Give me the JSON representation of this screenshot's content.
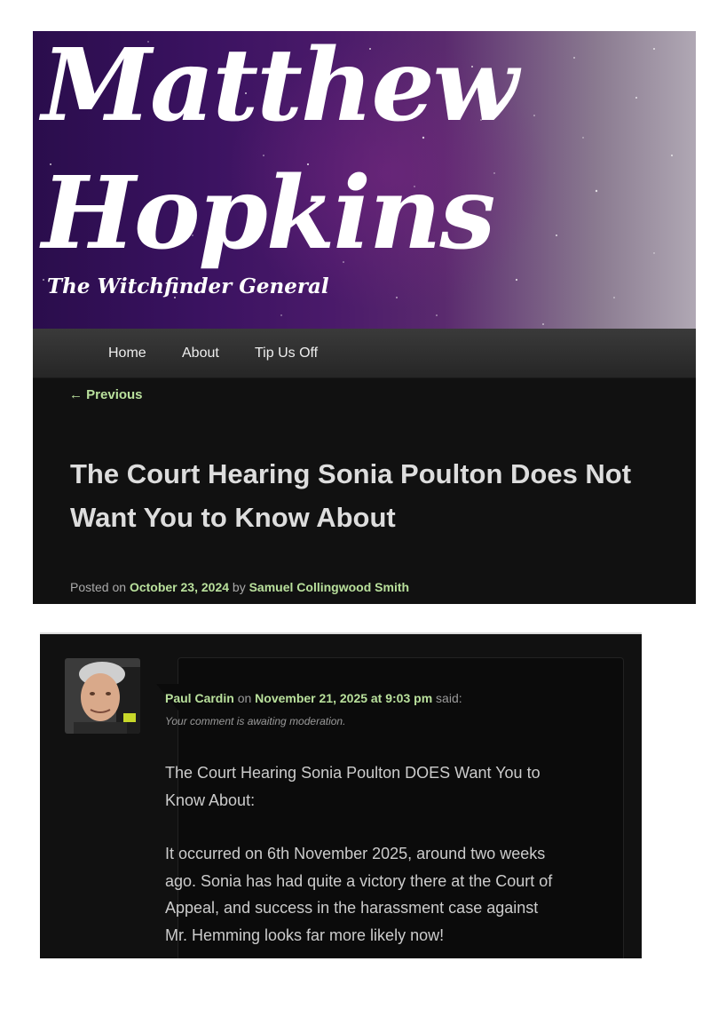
{
  "header": {
    "title_line1": "Matthew",
    "title_line2": "Hopkins",
    "tagline": "The Witchfinder General"
  },
  "nav": {
    "items": [
      {
        "label": "Home"
      },
      {
        "label": "About"
      },
      {
        "label": "Tip Us Off"
      }
    ]
  },
  "post": {
    "previous_label": "← Previous",
    "title": "The Court Hearing Sonia Poulton Does Not Want You to Know About",
    "meta_posted_on": "Posted on",
    "date": "October 23, 2024",
    "meta_by": "by",
    "author": "Samuel Collingwood Smith"
  },
  "comment": {
    "author": "Paul Cardin",
    "on_label": "on",
    "date": "November 21, 2025 at 9:03 pm",
    "said_label": "said:",
    "moderation_note": "Your comment is awaiting moderation.",
    "paragraphs": [
      "The Court Hearing Sonia Poulton DOES Want You to Know About:",
      "It occurred on 6th November 2025, around two weeks ago. Sonia has had quite a victory there at the Court of Appeal, and success in the harassment case against Mr. Hemming looks far more likely now!"
    ]
  },
  "colors": {
    "link_green": "#b9e09c",
    "page_bg": "#111111",
    "banner_purple": "#3a1260"
  },
  "icons": {
    "avatar": "commenter-avatar-photo"
  }
}
